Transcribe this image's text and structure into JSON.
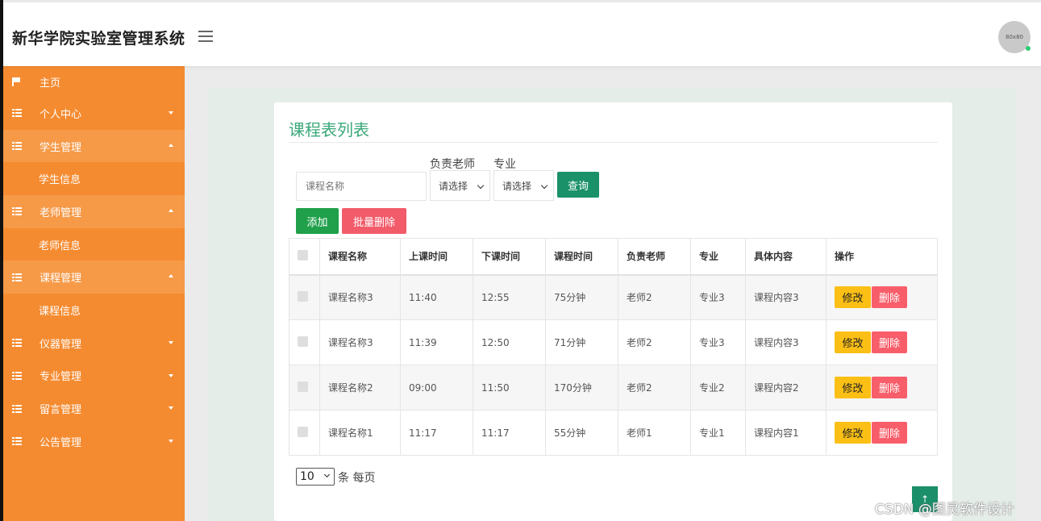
{
  "app": {
    "title": "新华学院实验室管理系统",
    "avatar_text": "80x80"
  },
  "sidebar": {
    "items": [
      {
        "label": "主页",
        "icon": "flag-icon",
        "type": "top"
      },
      {
        "label": "个人中心",
        "icon": "grid-icon",
        "caret": "down"
      },
      {
        "label": "学生管理",
        "icon": "grid-icon",
        "caret": "up",
        "open": true
      },
      {
        "label": "学生信息",
        "type": "sub"
      },
      {
        "label": "老师管理",
        "icon": "grid-icon",
        "caret": "up",
        "open": true
      },
      {
        "label": "老师信息",
        "type": "sub"
      },
      {
        "label": "课程管理",
        "icon": "grid-icon",
        "caret": "up",
        "open": true
      },
      {
        "label": "课程信息",
        "type": "sub"
      },
      {
        "label": "仪器管理",
        "icon": "grid-icon",
        "caret": "down"
      },
      {
        "label": "专业管理",
        "icon": "grid-icon",
        "caret": "down"
      },
      {
        "label": "留言管理",
        "icon": "grid-icon",
        "caret": "down"
      },
      {
        "label": "公告管理",
        "icon": "grid-icon",
        "caret": "down"
      }
    ]
  },
  "main": {
    "panel_title": "课程表列表",
    "filters": {
      "course_placeholder": "课程名称",
      "teacher_label": "负责老师",
      "teacher_value": "请选择",
      "major_label": "专业",
      "major_value": "请选择",
      "query_label": "查询"
    },
    "actions": {
      "add_label": "添加",
      "bulk_delete_label": "批量删除"
    },
    "table": {
      "headers": [
        "课程名称",
        "上课时间",
        "下课时间",
        "课程时间",
        "负责老师",
        "专业",
        "具体内容",
        "操作"
      ],
      "rows": [
        [
          "课程名称3",
          "11:40",
          "12:55",
          "75分钟",
          "老师2",
          "专业3",
          "课程内容3"
        ],
        [
          "课程名称3",
          "11:39",
          "12:50",
          "71分钟",
          "老师2",
          "专业3",
          "课程内容3"
        ],
        [
          "课程名称2",
          "09:00",
          "11:50",
          "170分钟",
          "老师2",
          "专业2",
          "课程内容2"
        ],
        [
          "课程名称1",
          "11:17",
          "11:17",
          "55分钟",
          "老师1",
          "专业1",
          "课程内容1"
        ]
      ],
      "edit_label": "修改",
      "delete_label": "删除"
    },
    "pager": {
      "page_size": "10",
      "suffix": "条 每页"
    }
  },
  "watermark": "CSDN @图灵软件设计",
  "colors": {
    "sidebar": "#f58b30",
    "accent": "#3aa87a",
    "edit": "#fbbf15",
    "delete": "#f85e6a"
  }
}
